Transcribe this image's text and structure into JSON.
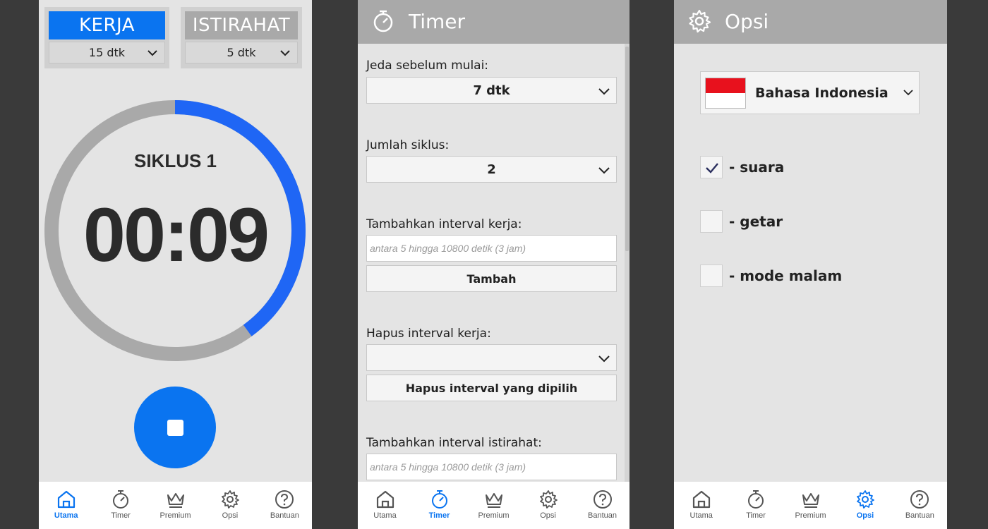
{
  "screen_main": {
    "work_title": "KERJA",
    "work_duration": "15 dtk",
    "rest_title": "ISTIRAHAT",
    "rest_duration": "5 dtk",
    "cycle_label": "SIKLUS 1",
    "time": "00:09",
    "progress_fraction": 0.4,
    "colors": {
      "accent": "#0a74f0",
      "ring_track": "#a9a9a9"
    }
  },
  "screen_timer": {
    "header_title": "Timer",
    "delay_label": "Jeda sebelum mulai:",
    "delay_value": "7 dtk",
    "cycles_label": "Jumlah siklus:",
    "cycles_value": "2",
    "add_work_label": "Tambahkan interval kerja:",
    "add_work_placeholder": "antara 5 hingga 10800 detik (3 jam)",
    "add_button": "Tambah",
    "remove_work_label": "Hapus interval kerja:",
    "remove_work_value": "",
    "remove_button": "Hapus interval yang dipilih",
    "add_rest_label": "Tambahkan interval istirahat:",
    "add_rest_placeholder": "antara 5 hingga 10800 detik (3 jam)"
  },
  "screen_options": {
    "header_title": "Opsi",
    "language": "Bahasa Indonesia",
    "options": [
      {
        "label": "- suara",
        "checked": true
      },
      {
        "label": "- getar",
        "checked": false
      },
      {
        "label": "- mode malam",
        "checked": false
      }
    ]
  },
  "nav": {
    "items": [
      "Utama",
      "Timer",
      "Premium",
      "Opsi",
      "Bantuan"
    ],
    "icons": [
      "home-icon",
      "stopwatch-icon",
      "crown-icon",
      "gear-icon",
      "help-icon"
    ]
  }
}
